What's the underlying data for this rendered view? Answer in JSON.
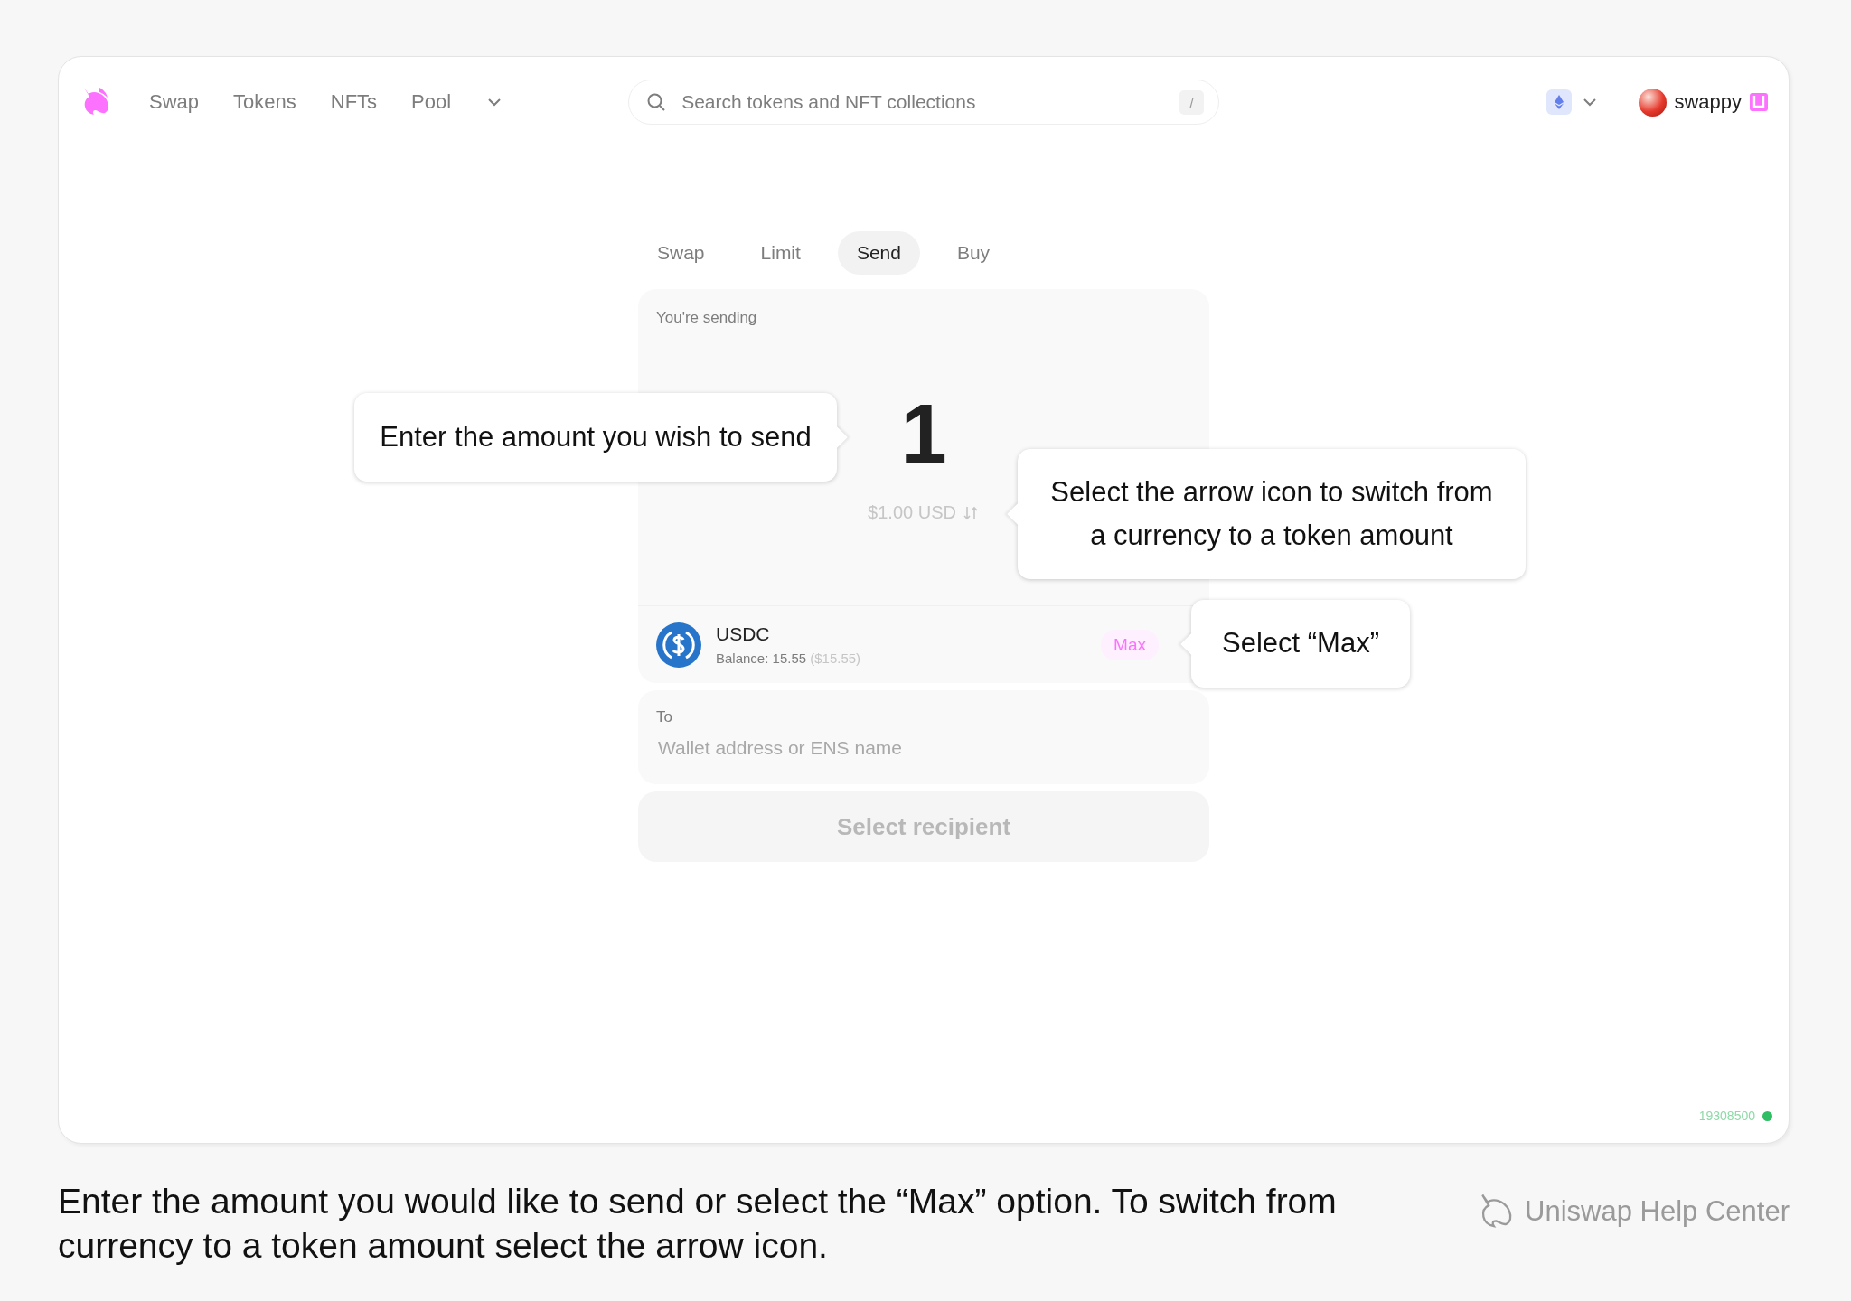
{
  "nav": {
    "items": [
      {
        "label": "Swap"
      },
      {
        "label": "Tokens"
      },
      {
        "label": "NFTs"
      },
      {
        "label": "Pool"
      }
    ]
  },
  "search": {
    "placeholder": "Search tokens and NFT collections",
    "shortcut": "/"
  },
  "account": {
    "name": "swappy"
  },
  "tabs": [
    {
      "label": "Swap",
      "selected": false
    },
    {
      "label": "Limit",
      "selected": false
    },
    {
      "label": "Send",
      "selected": true
    },
    {
      "label": "Buy",
      "selected": false
    }
  ],
  "send": {
    "label": "You're sending",
    "amount": "1",
    "converted": "$1.00 USD",
    "token": "USDC",
    "balance": "Balance: 15.55",
    "balance_usd": "($15.55)",
    "max": "Max"
  },
  "recipient": {
    "label": "To",
    "placeholder": "Wallet address or ENS name",
    "button": "Select recipient"
  },
  "block_number": "19308500",
  "callouts": [
    {
      "text": "Enter the amount you wish to send"
    },
    {
      "text": "Select the arrow icon to switch from a currency to a token amount"
    },
    {
      "text": "Select “Max”"
    }
  ],
  "caption": "Enter the amount you would like to send or select the “Max” option. To switch from currency to a token amount select the arrow icon.",
  "brand": "Uniswap Help Center"
}
